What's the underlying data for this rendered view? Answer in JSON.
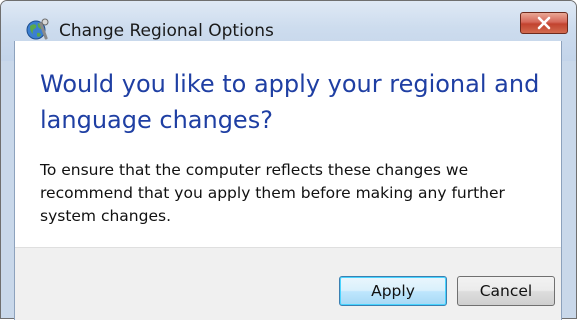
{
  "window": {
    "title": "Change Regional Options",
    "icon": "globe-icon",
    "close_icon": "close-icon"
  },
  "content": {
    "main_instruction": "Would you like to apply your regional and language changes?",
    "body": "To ensure that the computer reflects these changes we recommend that you apply them before making any further system changes."
  },
  "buttons": {
    "apply_label": "Apply",
    "cancel_label": "Cancel"
  },
  "colors": {
    "main_instruction": "#1f3fa3",
    "close_button": "#c2432f",
    "frame": "#c9d8ea"
  }
}
